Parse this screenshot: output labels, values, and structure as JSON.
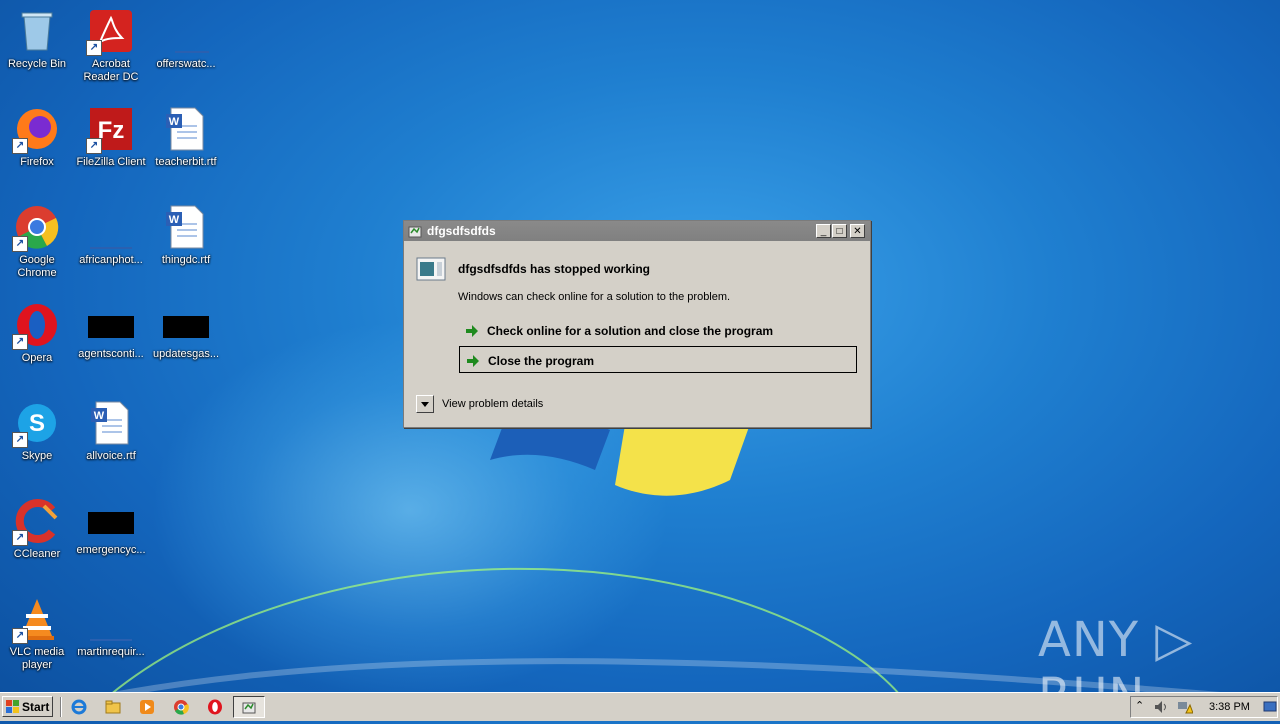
{
  "desktop": {
    "icons": [
      {
        "label": "Recycle Bin",
        "icon": "recycle-bin-icon"
      },
      {
        "label": "Acrobat Reader DC",
        "icon": "acrobat-icon"
      },
      {
        "label": "offerswatc...",
        "icon": "blank-file-icon"
      },
      {
        "label": "Firefox",
        "icon": "firefox-icon"
      },
      {
        "label": "FileZilla Client",
        "icon": "filezilla-icon"
      },
      {
        "label": "teacherbit.rtf",
        "icon": "word-doc-icon"
      },
      {
        "label": "Google Chrome",
        "icon": "chrome-icon"
      },
      {
        "label": "africanphot...",
        "icon": "blank-file-icon"
      },
      {
        "label": "thingdc.rtf",
        "icon": "word-doc-icon"
      },
      {
        "label": "Opera",
        "icon": "opera-icon"
      },
      {
        "label": "agentsconti...",
        "icon": "black-file-icon"
      },
      {
        "label": "updatesgas...",
        "icon": "black-file-icon"
      },
      {
        "label": "Skype",
        "icon": "skype-icon"
      },
      {
        "label": "allvoice.rtf",
        "icon": "word-doc-icon"
      },
      {
        "label": "CCleaner",
        "icon": "ccleaner-icon"
      },
      {
        "label": "emergencyc...",
        "icon": "black-file-icon"
      },
      {
        "label": "VLC media player",
        "icon": "vlc-icon"
      },
      {
        "label": "martinrequir...",
        "icon": "blank-file-icon"
      }
    ]
  },
  "dialog": {
    "window_title": "dfgsdfsdfds",
    "heading": "dfgsdfsdfds has stopped working",
    "message": "Windows can check online for a solution to the problem.",
    "option_check_online": "Check online for a solution and close the program",
    "option_close": "Close the program",
    "details_label": "View problem details",
    "minimize_glyph": "_",
    "maximize_glyph": "□",
    "close_glyph": "✕"
  },
  "taskbar": {
    "start_label": "Start",
    "clock": "3:38 PM"
  },
  "watermark": "ANY ▷ RUN",
  "colors": {
    "desktop_blue": "#1f7fd0",
    "dialog_bg": "#d4d0c8",
    "titlebar_inactive": "#808080",
    "arrow_green": "#1e8a1e"
  }
}
